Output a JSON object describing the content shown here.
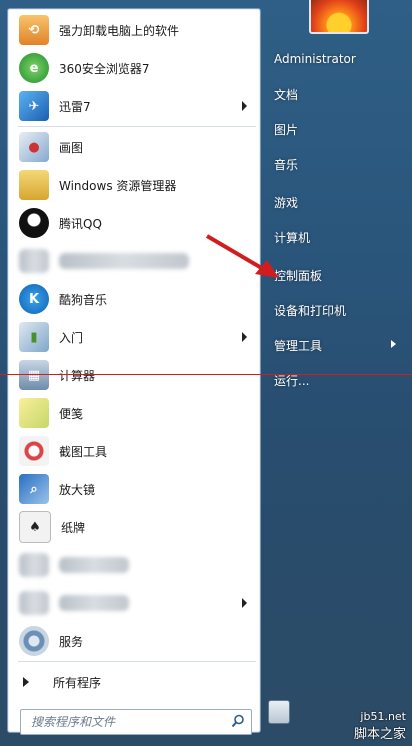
{
  "pinned": [
    {
      "label": "强力卸载电脑上的软件",
      "icon": "uninstall-icon",
      "color": "#f0a33a"
    },
    {
      "label": "360安全浏览器7",
      "icon": "360-browser-icon",
      "color": "#39a935"
    },
    {
      "label": "迅雷7",
      "icon": "thunder-icon",
      "color": "#2a7fd6",
      "submenu": true
    }
  ],
  "recent": [
    {
      "label": "画图",
      "icon": "paint-icon",
      "color": "#6aa2d6"
    },
    {
      "label": "Windows 资源管理器",
      "icon": "explorer-folder-icon",
      "color": "#e8c14a"
    },
    {
      "label": "腾讯QQ",
      "icon": "qq-penguin-icon",
      "color": "#222222"
    },
    {
      "label": "",
      "icon": "blurred-app-icon",
      "color": "#9aa3ad",
      "blurred": true
    },
    {
      "label": "酷狗音乐",
      "icon": "kugou-icon",
      "color": "#1e88d6"
    },
    {
      "label": "入门",
      "icon": "getting-started-icon",
      "color": "#5c9a3a",
      "submenu": true
    },
    {
      "label": "计算器",
      "icon": "calculator-icon",
      "color": "#7d95b0"
    },
    {
      "label": "便笺",
      "icon": "sticky-notes-icon",
      "color": "#e6d64a"
    },
    {
      "label": "截图工具",
      "icon": "snipping-tool-icon",
      "color": "#c94040"
    },
    {
      "label": "放大镜",
      "icon": "magnifier-icon",
      "color": "#3a72b8"
    },
    {
      "label": "纸牌",
      "icon": "solitaire-icon",
      "color": "#444444"
    },
    {
      "label": "",
      "icon": "blurred-app-icon",
      "color": "#9aa3ad",
      "blurred": true
    },
    {
      "label": "",
      "icon": "blurred-app-icon",
      "color": "#9aa3ad",
      "blurred": true,
      "submenu": true
    },
    {
      "label": "服务",
      "icon": "services-gear-icon",
      "color": "#6b8fb5"
    }
  ],
  "all_programs": "所有程序",
  "search": {
    "placeholder": "搜索程序和文件"
  },
  "right_items": [
    {
      "label": "Administrator"
    },
    {
      "label": "文档"
    },
    {
      "label": "图片"
    },
    {
      "label": "音乐"
    },
    {
      "label": "游戏"
    },
    {
      "label": "计算机"
    },
    {
      "label": "控制面板"
    },
    {
      "label": "设备和打印机"
    },
    {
      "label": "管理工具",
      "submenu": true
    },
    {
      "label": "运行..."
    }
  ],
  "watermark": {
    "site": "脚本之家",
    "domain": "jb51.net"
  },
  "colors": {
    "annotation": "#d11d1d",
    "taskbar": "#2a557b"
  }
}
